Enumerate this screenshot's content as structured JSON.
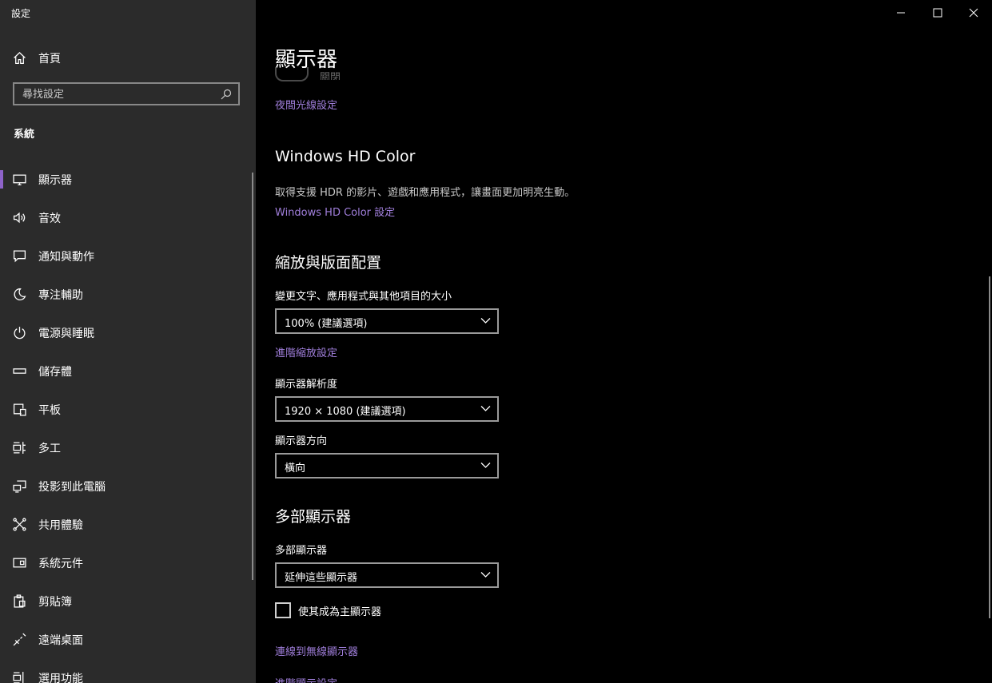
{
  "window": {
    "title": "設定"
  },
  "sidebar": {
    "home_label": "首頁",
    "search_placeholder": "尋找設定",
    "section_label": "系統",
    "items": [
      {
        "label": "顯示器",
        "icon": "monitor-icon",
        "selected": true
      },
      {
        "label": "音效",
        "icon": "speaker-icon"
      },
      {
        "label": "通知與動作",
        "icon": "notification-icon"
      },
      {
        "label": "專注輔助",
        "icon": "moon-icon"
      },
      {
        "label": "電源與睡眠",
        "icon": "power-icon"
      },
      {
        "label": "儲存體",
        "icon": "storage-icon"
      },
      {
        "label": "平板",
        "icon": "tablet-icon"
      },
      {
        "label": "多工",
        "icon": "multitasking-icon"
      },
      {
        "label": "投影到此電腦",
        "icon": "projection-icon"
      },
      {
        "label": "共用體驗",
        "icon": "shared-experience-icon"
      },
      {
        "label": "系統元件",
        "icon": "system-components-icon"
      },
      {
        "label": "剪貼簿",
        "icon": "clipboard-icon"
      },
      {
        "label": "遠端桌面",
        "icon": "remote-desktop-icon"
      },
      {
        "label": "選用功能",
        "icon": "optional-features-icon"
      }
    ]
  },
  "main": {
    "page_title": "顯示器",
    "night_light": {
      "toggle_state": "關閉",
      "settings_link": "夜間光線設定"
    },
    "hd_color": {
      "heading": "Windows HD Color",
      "description": "取得支援 HDR 的影片、遊戲和應用程式，讓畫面更加明亮生動。",
      "link": "Windows HD Color 設定"
    },
    "scale_layout": {
      "heading": "縮放與版面配置",
      "scale_label": "變更文字、應用程式與其他項目的大小",
      "scale_value": "100% (建議選項)",
      "advanced_scaling_link": "進階縮放設定",
      "resolution_label": "顯示器解析度",
      "resolution_value": "1920 × 1080 (建議選項)",
      "orientation_label": "顯示器方向",
      "orientation_value": "橫向"
    },
    "multiple_displays": {
      "heading": "多部顯示器",
      "label": "多部顯示器",
      "value": "延伸這些顯示器",
      "main_display_checkbox": "使其成為主顯示器",
      "main_display_checked": false,
      "wireless_link": "連線到無線顯示器",
      "advanced_display_link": "進階顯示設定"
    }
  },
  "colors": {
    "accent": "#8e63c9",
    "link": "#a17fdc",
    "sidebar_bg": "#2b2b2b",
    "content_bg": "#000000"
  }
}
